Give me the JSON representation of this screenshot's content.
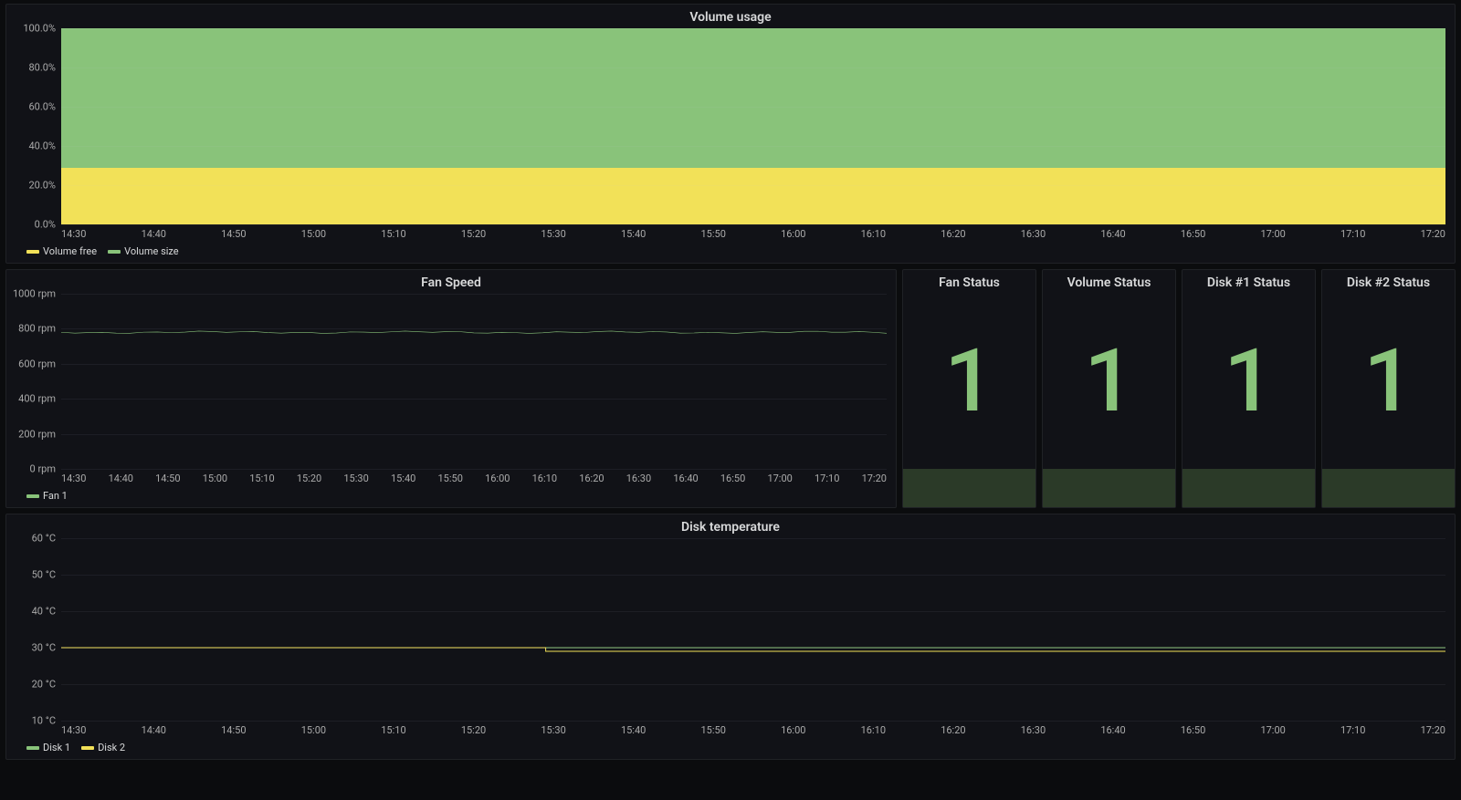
{
  "colors": {
    "green": "#89c37a",
    "yellow": "#f2e158"
  },
  "volume": {
    "title": "Volume usage",
    "y_ticks": [
      "0.0%",
      "20.0%",
      "40.0%",
      "60.0%",
      "80.0%",
      "100.0%"
    ],
    "x_ticks": [
      "14:30",
      "14:40",
      "14:50",
      "15:00",
      "15:10",
      "15:20",
      "15:30",
      "15:40",
      "15:50",
      "16:00",
      "16:10",
      "16:20",
      "16:30",
      "16:40",
      "16:50",
      "17:00",
      "17:10",
      "17:20"
    ],
    "legend": [
      {
        "label": "Volume free",
        "color": "#f2e158"
      },
      {
        "label": "Volume size",
        "color": "#89c37a"
      }
    ],
    "free_pct": 29,
    "size_pct": 100
  },
  "fan": {
    "title": "Fan Speed",
    "y_ticks": [
      "0 rpm",
      "200 rpm",
      "400 rpm",
      "600 rpm",
      "800 rpm",
      "1000 rpm"
    ],
    "x_ticks": [
      "14:30",
      "14:40",
      "14:50",
      "15:00",
      "15:10",
      "15:20",
      "15:30",
      "15:40",
      "15:50",
      "16:00",
      "16:10",
      "16:20",
      "16:30",
      "16:40",
      "16:50",
      "17:00",
      "17:10",
      "17:20"
    ],
    "legend": [
      {
        "label": "Fan 1",
        "color": "#89c37a"
      }
    ],
    "value_rpm": 780,
    "y_max": 1000
  },
  "stats": [
    {
      "title": "Fan Status",
      "value": "1"
    },
    {
      "title": "Volume Status",
      "value": "1"
    },
    {
      "title": "Disk #1 Status",
      "value": "1"
    },
    {
      "title": "Disk #2 Status",
      "value": "1"
    }
  ],
  "disk": {
    "title": "Disk temperature",
    "y_ticks": [
      "10 °C",
      "20 °C",
      "30 °C",
      "40 °C",
      "50 °C",
      "60 °C"
    ],
    "y_min": 10,
    "y_max": 60,
    "x_ticks": [
      "14:30",
      "14:40",
      "14:50",
      "15:00",
      "15:10",
      "15:20",
      "15:30",
      "15:40",
      "15:50",
      "16:00",
      "16:10",
      "16:20",
      "16:30",
      "16:40",
      "16:50",
      "17:00",
      "17:10",
      "17:20"
    ],
    "legend": [
      {
        "label": "Disk 1",
        "color": "#89c37a"
      },
      {
        "label": "Disk 2",
        "color": "#f2e158"
      }
    ],
    "disk1_c": 30,
    "disk2_before": 30,
    "disk2_after": 29,
    "disk2_step_frac": 0.35
  },
  "chart_data": [
    {
      "type": "area",
      "title": "Volume usage",
      "xlabel": "",
      "ylabel": "%",
      "ylim": [
        0,
        100
      ],
      "categories": [
        "14:30",
        "14:40",
        "14:50",
        "15:00",
        "15:10",
        "15:20",
        "15:30",
        "15:40",
        "15:50",
        "16:00",
        "16:10",
        "16:20",
        "16:30",
        "16:40",
        "16:50",
        "17:00",
        "17:10",
        "17:20"
      ],
      "series": [
        {
          "name": "Volume free",
          "values": [
            29,
            29,
            29,
            29,
            29,
            29,
            29,
            29,
            29,
            29,
            29,
            29,
            29,
            29,
            29,
            29,
            29,
            29
          ]
        },
        {
          "name": "Volume size",
          "values": [
            100,
            100,
            100,
            100,
            100,
            100,
            100,
            100,
            100,
            100,
            100,
            100,
            100,
            100,
            100,
            100,
            100,
            100
          ]
        }
      ]
    },
    {
      "type": "line",
      "title": "Fan Speed",
      "xlabel": "",
      "ylabel": "rpm",
      "ylim": [
        0,
        1000
      ],
      "categories": [
        "14:30",
        "14:40",
        "14:50",
        "15:00",
        "15:10",
        "15:20",
        "15:30",
        "15:40",
        "15:50",
        "16:00",
        "16:10",
        "16:20",
        "16:30",
        "16:40",
        "16:50",
        "17:00",
        "17:10",
        "17:20"
      ],
      "series": [
        {
          "name": "Fan 1",
          "values": [
            780,
            780,
            780,
            780,
            780,
            780,
            780,
            780,
            780,
            780,
            780,
            780,
            780,
            780,
            780,
            780,
            780,
            780
          ]
        }
      ]
    },
    {
      "type": "line",
      "title": "Disk temperature",
      "xlabel": "",
      "ylabel": "°C",
      "ylim": [
        10,
        60
      ],
      "categories": [
        "14:30",
        "14:40",
        "14:50",
        "15:00",
        "15:10",
        "15:20",
        "15:30",
        "15:40",
        "15:50",
        "16:00",
        "16:10",
        "16:20",
        "16:30",
        "16:40",
        "16:50",
        "17:00",
        "17:10",
        "17:20"
      ],
      "series": [
        {
          "name": "Disk 1",
          "values": [
            30,
            30,
            30,
            30,
            30,
            30,
            30,
            30,
            30,
            30,
            30,
            30,
            30,
            30,
            30,
            30,
            30,
            30
          ]
        },
        {
          "name": "Disk 2",
          "values": [
            30,
            30,
            30,
            30,
            30,
            30,
            29,
            29,
            29,
            29,
            29,
            29,
            29,
            29,
            29,
            29,
            29,
            29
          ]
        }
      ]
    }
  ]
}
